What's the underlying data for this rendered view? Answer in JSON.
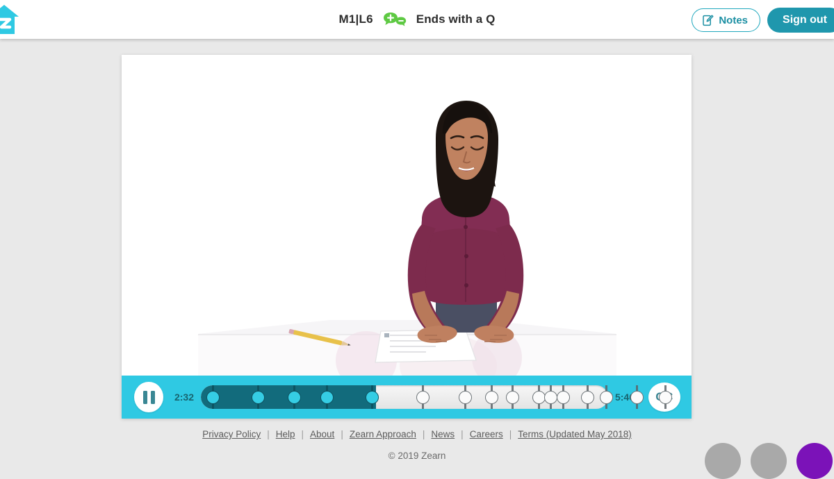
{
  "header": {
    "logo_name": "zearn-logo",
    "lesson_code": "M1|L6",
    "lesson_icon": "chat-bubbles-plus-minus-icon",
    "lesson_title": "Ends with a Q",
    "notes_label": "Notes",
    "notes_icon": "note-pencil-icon",
    "signout_label": "Sign out",
    "accent_teal": "#1f97ad",
    "accent_cyan": "#2fc9e3",
    "icon_green": "#5ec943"
  },
  "player": {
    "play_state_icon": "pause-icon",
    "current_time": "2:32",
    "total_time": "5:46",
    "cc_label": "CC",
    "progress_percent": 43,
    "track_fill_color": "#126b7c",
    "markers": [
      {
        "pos": 3,
        "played": true
      },
      {
        "pos": 14,
        "played": true
      },
      {
        "pos": 23,
        "played": true
      },
      {
        "pos": 31,
        "played": true
      },
      {
        "pos": 42,
        "played": true
      },
      {
        "pos": 54.5,
        "played": false
      },
      {
        "pos": 65,
        "played": false
      },
      {
        "pos": 71.5,
        "played": false
      },
      {
        "pos": 76.5,
        "played": false
      },
      {
        "pos": 83,
        "played": false
      },
      {
        "pos": 86,
        "played": false
      },
      {
        "pos": 89,
        "played": false
      },
      {
        "pos": 95,
        "played": false
      },
      {
        "pos": 99.5,
        "played": false
      },
      {
        "pos": 107,
        "played": false
      },
      {
        "pos": 114,
        "played": false
      }
    ]
  },
  "video": {
    "alt": "teacher-at-white-table-with-paper-and-pencil",
    "shirt_color": "#7d2b4d",
    "skirt_color": "#4a4f63",
    "hair_color": "#1c1410",
    "skin_color": "#b8795a",
    "pencil_color": "#e8c14a"
  },
  "footer": {
    "links": [
      "Privacy Policy",
      "Help",
      "About",
      "Zearn Approach",
      "News",
      "Careers",
      "Terms (Updated May 2018)"
    ],
    "separator": "|",
    "copyright": "© 2019 Zearn"
  },
  "corner_widgets": [
    {
      "name": "help-bubble-1",
      "color": "#a9a9a9"
    },
    {
      "name": "help-bubble-2",
      "color": "#a9a9a9"
    },
    {
      "name": "chat-bubble-purple",
      "color": "#7b12b8"
    }
  ]
}
